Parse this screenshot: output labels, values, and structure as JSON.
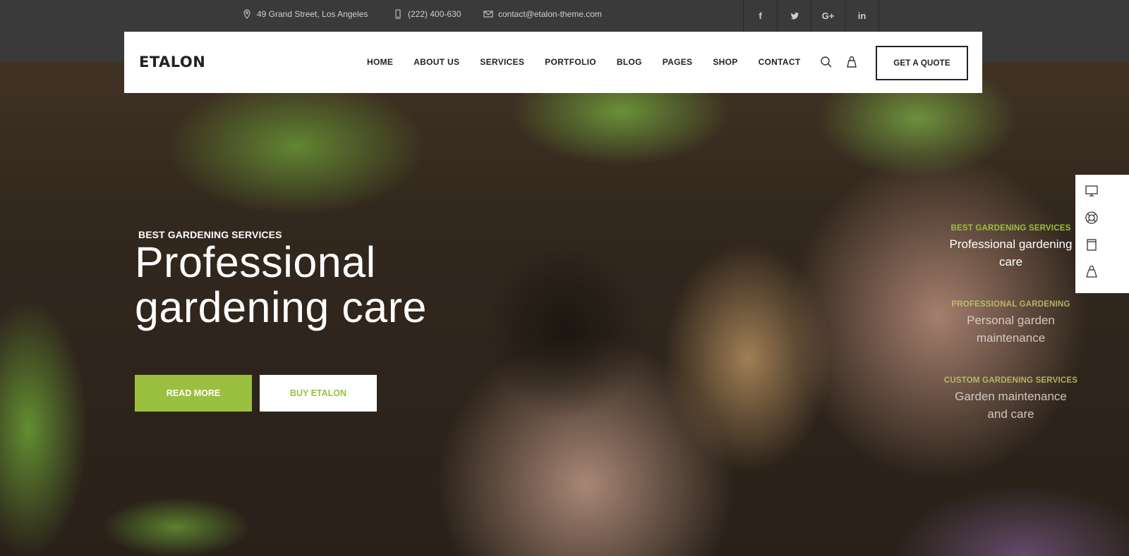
{
  "topbar": {
    "address": "49 Grand Street, Los Angeles",
    "phone": "(222) 400-630",
    "email": "contact@etalon-theme.com",
    "social": [
      {
        "icon": "facebook-icon",
        "glyph": "f"
      },
      {
        "icon": "twitter-icon",
        "glyph": "t"
      },
      {
        "icon": "google-plus-icon",
        "glyph": "G+"
      },
      {
        "icon": "linkedin-icon",
        "glyph": "in"
      }
    ]
  },
  "header": {
    "logo": "ETALON",
    "nav": [
      "HOME",
      "ABOUT US",
      "SERVICES",
      "PORTFOLIO",
      "BLOG",
      "PAGES",
      "SHOP",
      "CONTACT"
    ],
    "search_icon": "search-icon",
    "cart_icon": "shopping-bag-icon",
    "quote_button": "GET A QUOTE"
  },
  "hero": {
    "eyebrow": "BEST GARDENING SERVICES",
    "headline_line1": "Professional",
    "headline_line2": "gardening care",
    "primary_button": "READ MORE",
    "secondary_button": "BUY ETALON",
    "accent_color": "#9bc03f"
  },
  "slider_nav": [
    {
      "tag": "BEST GARDENING SERVICES",
      "title_line1": "Professional gardening",
      "title_line2": "care",
      "active": true
    },
    {
      "tag": "PROFESSIONAL GARDENING",
      "title_line1": "Personal garden",
      "title_line2": "maintenance",
      "active": false
    },
    {
      "tag": "CUSTOM GARDENING SERVICES",
      "title_line1": "Garden maintenance",
      "title_line2": "and care",
      "active": false
    }
  ],
  "side_tools": [
    "monitor-icon",
    "lifebuoy-icon",
    "document-icon",
    "shopping-bag-icon"
  ]
}
